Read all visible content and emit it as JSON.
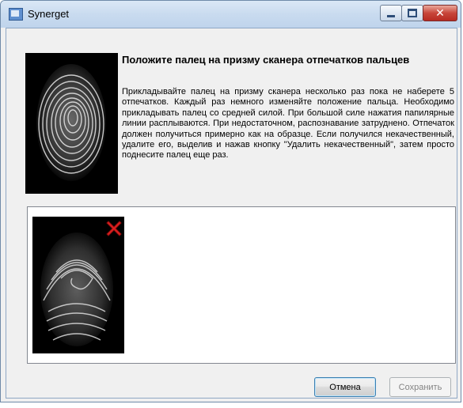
{
  "window": {
    "title": "Synerget",
    "close_glyph": "✕"
  },
  "heading": "Положите палец на призму сканера отпечатков пальцев",
  "instructions": "Прикладывайте палец на призму сканера несколько раз пока не наберете 5 отпечатков. Каждый раз немного изменяйте положение пальца. Необходимо прикладывать палец со средней силой. При большой силе нажатия папилярные линии расплываются. При недостаточном, распознавание затруднено. Отпечаток должен получиться примерно как на образце. Если получился некачественный, удалите его, выделив и нажав кнопку \"Удалить некачественный\", затем просто поднесите палец еще раз.",
  "buttons": {
    "cancel": "Отмена",
    "save": "Сохранить"
  },
  "icons": {
    "app": "app-window-icon",
    "minimize": "minimize-icon",
    "maximize": "maximize-icon",
    "close": "close-icon",
    "delete_mark": "red-x-icon"
  },
  "colors": {
    "close_button": "#c8463a",
    "delete_mark": "#e02020",
    "focus_border": "#3c7fb1"
  }
}
